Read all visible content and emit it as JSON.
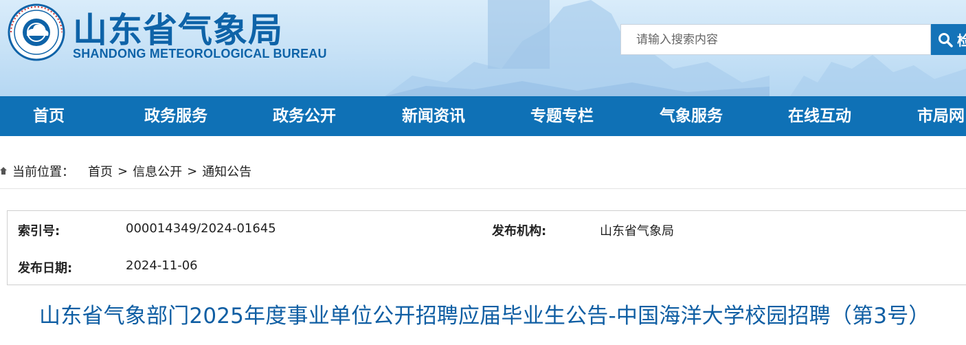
{
  "header": {
    "title": "山东省气象局",
    "subtitle": "SHANDONG METEOROLOGICAL BUREAU",
    "search_placeholder": "请输入搜索内容",
    "search_button_label": "检",
    "colors": {
      "brand": "#0e63a8",
      "banner": "#c6e1f6"
    }
  },
  "nav": {
    "items": [
      {
        "label": "首页"
      },
      {
        "label": "政务服务"
      },
      {
        "label": "政务公开"
      },
      {
        "label": "新闻资讯"
      },
      {
        "label": "专题专栏"
      },
      {
        "label": "气象服务"
      },
      {
        "label": "在线互动"
      },
      {
        "label": "市局网"
      }
    ],
    "color": "#0f71b6"
  },
  "breadcrumb": {
    "prefix": "当前位置：",
    "items": [
      "首页",
      "信息公开",
      "通知公告"
    ],
    "separator": ">"
  },
  "info": {
    "index_label": "索引号:",
    "index_value": "000014349/2024-01645",
    "publisher_label": "发布机构:",
    "publisher_value": "山东省气象局",
    "date_label": "发布日期:",
    "date_value": "2024-11-06"
  },
  "article": {
    "title": "山东省气象部门2025年度事业单位公开招聘应届毕业生公告-中国海洋大学校园招聘（第3号）",
    "title_color": "#0f5ea3"
  }
}
